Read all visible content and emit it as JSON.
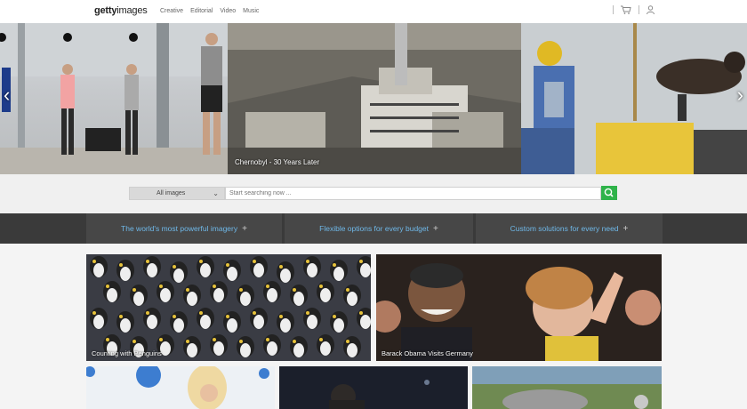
{
  "header": {
    "logo_bold": "getty",
    "logo_rest": "images",
    "nav": [
      "Creative",
      "Editorial",
      "Video",
      "Music"
    ]
  },
  "hero": {
    "caption": "Chernobyl - 30 Years Later"
  },
  "search": {
    "category_selected": "All images",
    "placeholder": "Start searching now ..."
  },
  "features": [
    {
      "label": "The world's most powerful imagery"
    },
    {
      "label": "Flexible options for every budget"
    },
    {
      "label": "Custom solutions for every need"
    }
  ],
  "tiles": [
    {
      "label": "Counting with Penguins"
    },
    {
      "label": "Barack Obama Visits Germany"
    }
  ],
  "colors": {
    "accent_green": "#2fb34a",
    "link_blue": "#6fb8e8",
    "feature_bar": "#474747"
  }
}
